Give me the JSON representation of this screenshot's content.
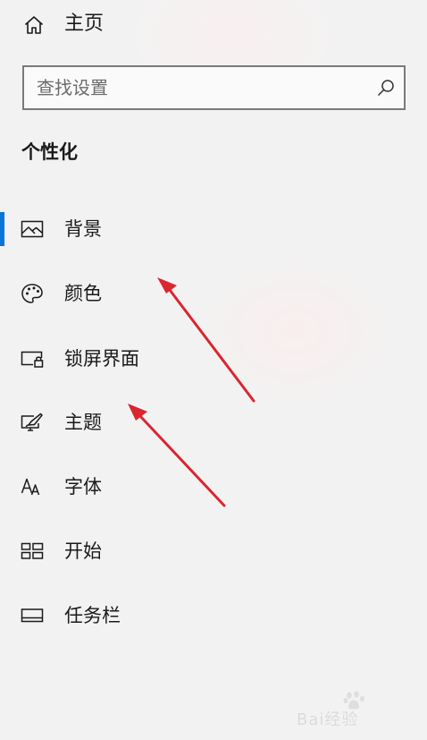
{
  "home": {
    "label": "主页",
    "icon": "home-icon"
  },
  "search": {
    "placeholder": "查找设置",
    "value": "",
    "icon": "search-icon"
  },
  "section_title": "个性化",
  "nav": {
    "items": [
      {
        "label": "背景",
        "icon": "picture-icon",
        "selected": true
      },
      {
        "label": "颜色",
        "icon": "palette-icon",
        "selected": false
      },
      {
        "label": "锁屏界面",
        "icon": "lock-screen-icon",
        "selected": false
      },
      {
        "label": "主题",
        "icon": "theme-brush-icon",
        "selected": false
      },
      {
        "label": "字体",
        "icon": "font-icon",
        "selected": false
      },
      {
        "label": "开始",
        "icon": "start-tiles-icon",
        "selected": false
      },
      {
        "label": "任务栏",
        "icon": "taskbar-icon",
        "selected": false
      }
    ]
  },
  "colors": {
    "accent": "#0a74d6",
    "background": "#f2f2f2",
    "text": "#1a1a1a",
    "annotation_arrow": "#d9262f"
  },
  "watermark": {
    "text": "Bai经验"
  }
}
